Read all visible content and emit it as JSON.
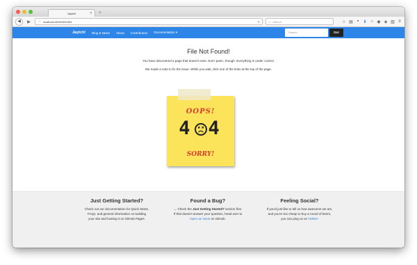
{
  "browser": {
    "tab_title": "Jaytch!",
    "url": "localhost:4000/404/404",
    "search_placeholder": "Search"
  },
  "site_nav": {
    "brand": "Jaytch!",
    "links": [
      "Blog & News",
      "About",
      "Contributors",
      "Documentation ▾"
    ],
    "search_placeholder": "Search",
    "go_label": "Go!"
  },
  "main": {
    "title": "File Not Found!",
    "message1": "You have discovered a page that doesn't exist. Don't panic, though. Everything is under control.",
    "message2": "We made a note to fix the issue. While you wait, click one of the links at the top of the page."
  },
  "note": {
    "top_text": "OOPS!",
    "code_left": "4",
    "code_right": "4",
    "bottom_text": "SORRY!"
  },
  "footer": {
    "col1": {
      "title": "Just Getting Started?",
      "line1": "Check out our documentation for Quick Starts,",
      "line2": "FAQs, and general information on building",
      "line3": "your site and hosting it on GitHub Pages."
    },
    "col2": {
      "title": "Found a Bug?",
      "line1_pre": "← Check the ",
      "line1_bold": "Just Getting Started?",
      "line1_post": " section first.",
      "line2": "If that doesn't answer your question, head over to",
      "link": "Open an issue",
      "line3_post": " on GitHub."
    },
    "col3": {
      "title": "Feeling Social?",
      "line1": "If you'd just like to tell us how awesome we are,",
      "line2": "and you're too cheap to buy a round of beers,",
      "line3_pre": "you can ping us on ",
      "link": "Twitter!"
    }
  },
  "colors": {
    "nav_blue": "#2e85e8",
    "note_yellow": "#fbe35a",
    "note_red": "#d93a2f",
    "link_blue": "#2e7fd8"
  }
}
